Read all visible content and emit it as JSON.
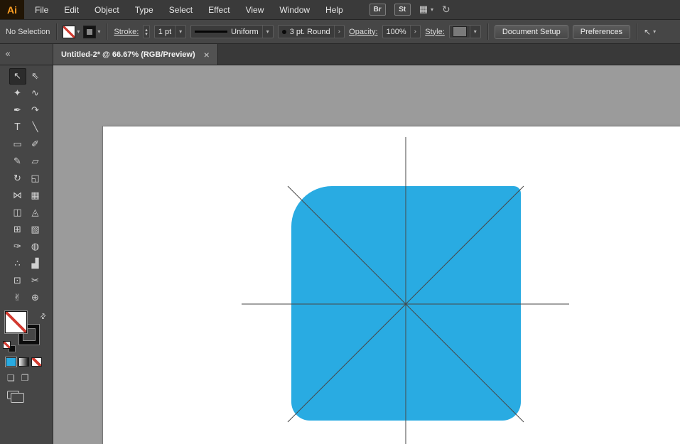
{
  "titlebar": {
    "logo": "Ai",
    "menus": [
      "File",
      "Edit",
      "Object",
      "Type",
      "Select",
      "Effect",
      "View",
      "Window",
      "Help"
    ],
    "bridge_label": "Br",
    "stock_label": "St",
    "arrange_icon": "▦",
    "sync_icon": "↻",
    "dropdown_glyph": "▾"
  },
  "control_bar": {
    "selection_status": "No Selection",
    "stroke_label": "Stroke:",
    "stroke_value": "1 pt",
    "width_profile_value": "Uniform",
    "brush_value": "3 pt. Round",
    "opacity_label": "Opacity:",
    "opacity_value": "100%",
    "style_label": "Style:",
    "document_setup_label": "Document Setup",
    "preferences_label": "Preferences",
    "dropdown_glyph": "▾",
    "chevron_glyph": "›",
    "stepper_up": "▴",
    "stepper_down": "▾",
    "select_similar_icon": "↖"
  },
  "tab_bar": {
    "collapse_glyph": "«",
    "tab_title": "Untitled-2* @ 66.67% (RGB/Preview)",
    "close_glyph": "×"
  },
  "tools": [
    {
      "name": "selection",
      "glyph": "↖",
      "selected": true
    },
    {
      "name": "direct-selection",
      "glyph": "⇖",
      "selected": false
    },
    {
      "name": "magic-wand",
      "glyph": "✦",
      "selected": false
    },
    {
      "name": "lasso",
      "glyph": "∿",
      "selected": false
    },
    {
      "name": "pen",
      "glyph": "✒",
      "selected": false
    },
    {
      "name": "curvature",
      "glyph": "↷",
      "selected": false
    },
    {
      "name": "type",
      "glyph": "T",
      "selected": false
    },
    {
      "name": "line-segment",
      "glyph": "╲",
      "selected": false
    },
    {
      "name": "rectangle",
      "glyph": "▭",
      "selected": false
    },
    {
      "name": "paintbrush",
      "glyph": "✐",
      "selected": false
    },
    {
      "name": "pencil",
      "glyph": "✎",
      "selected": false
    },
    {
      "name": "eraser",
      "glyph": "▱",
      "selected": false
    },
    {
      "name": "rotate",
      "glyph": "↻",
      "selected": false
    },
    {
      "name": "scale",
      "glyph": "◱",
      "selected": false
    },
    {
      "name": "width",
      "glyph": "⋈",
      "selected": false
    },
    {
      "name": "free-transform",
      "glyph": "▦",
      "selected": false
    },
    {
      "name": "shape-builder",
      "glyph": "◫",
      "selected": false
    },
    {
      "name": "perspective-grid",
      "glyph": "◬",
      "selected": false
    },
    {
      "name": "mesh",
      "glyph": "⊞",
      "selected": false
    },
    {
      "name": "gradient",
      "glyph": "▧",
      "selected": false
    },
    {
      "name": "eyedropper",
      "glyph": "✑",
      "selected": false
    },
    {
      "name": "blend",
      "glyph": "◍",
      "selected": false
    },
    {
      "name": "symbol-sprayer",
      "glyph": "∴",
      "selected": false
    },
    {
      "name": "column-graph",
      "glyph": "▟",
      "selected": false
    },
    {
      "name": "artboard",
      "glyph": "⊡",
      "selected": false
    },
    {
      "name": "slice",
      "glyph": "✂",
      "selected": false
    },
    {
      "name": "hand",
      "glyph": "✌",
      "selected": false
    },
    {
      "name": "zoom",
      "glyph": "⊕",
      "selected": false
    }
  ],
  "toolbar_footer": {
    "swap_glyph": "⇄",
    "color_button_color": "#29abe2",
    "drawing_mode_icons": [
      "❏",
      "❐"
    ]
  },
  "canvas": {
    "shape_fill": "#29abe2",
    "artboard_color": "#ffffff",
    "guide_color": "#474747"
  }
}
